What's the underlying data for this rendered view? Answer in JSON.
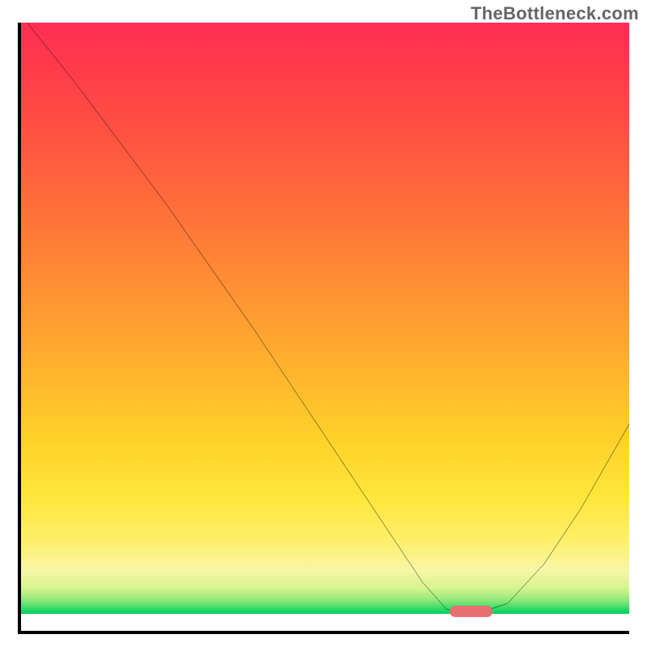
{
  "watermark": "TheBottleneck.com",
  "chart_data": {
    "type": "line",
    "title": "",
    "xlabel": "",
    "ylabel": "",
    "xlim": [
      0,
      100
    ],
    "ylim": [
      0,
      100
    ],
    "grid": false,
    "legend": false,
    "series": [
      {
        "name": "bottleneck-curve",
        "x": [
          1,
          9,
          15,
          24,
          38,
          50,
          60,
          66,
          70,
          73,
          76,
          80,
          86,
          92,
          100
        ],
        "y": [
          100,
          90,
          82,
          70,
          50,
          32,
          17,
          8,
          3.5,
          3.2,
          3.2,
          4.5,
          11,
          20,
          34
        ],
        "color": "#000000"
      }
    ],
    "marker": {
      "name": "optimal-range-pill",
      "x_center": 74,
      "y": 3.2,
      "width_pct": 7,
      "color": "#e86f72"
    },
    "background_gradient": {
      "stops": [
        {
          "pos": 0.0,
          "color": "#ff2d55"
        },
        {
          "pos": 0.5,
          "color": "#ffab2f"
        },
        {
          "pos": 0.8,
          "color": "#ffe63a"
        },
        {
          "pos": 0.95,
          "color": "#3ddc6b"
        },
        {
          "pos": 0.972,
          "color": "#0cc95a"
        },
        {
          "pos": 0.972,
          "color": "#ffffff"
        },
        {
          "pos": 1.0,
          "color": "#ffffff"
        }
      ]
    }
  }
}
